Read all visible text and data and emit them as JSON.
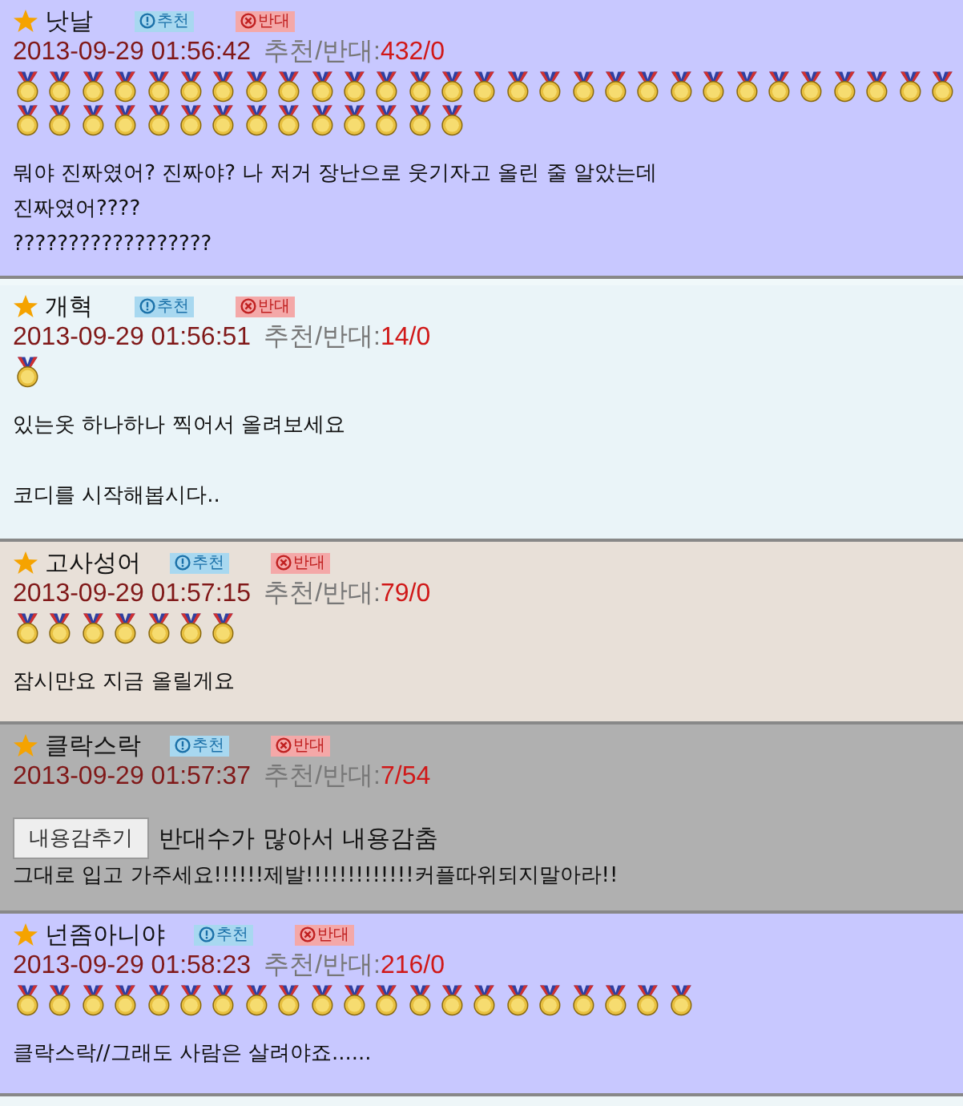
{
  "comments": [
    {
      "kind": "normal",
      "color": "#c8c8ff",
      "author": "낫날",
      "up_label": "추천",
      "down_label": "반대",
      "datetime": "2013-09-29 01:56:42",
      "votes_label": "추천/반대:",
      "votes": "432/0",
      "medals": [
        {
          "kind": "gold"
        },
        {
          "kind": "gold"
        },
        {
          "kind": "gold"
        },
        {
          "kind": "gold"
        },
        {
          "kind": "gold"
        },
        {
          "kind": "gold"
        },
        {
          "kind": "gold"
        },
        {
          "kind": "gold"
        },
        {
          "kind": "gold"
        },
        {
          "kind": "gold"
        },
        {
          "kind": "gold"
        },
        {
          "kind": "gold"
        },
        {
          "kind": "gold"
        },
        {
          "kind": "gold"
        },
        {
          "kind": "gold"
        },
        {
          "kind": "gold"
        },
        {
          "kind": "gold"
        },
        {
          "kind": "gold"
        },
        {
          "kind": "gold"
        },
        {
          "kind": "gold"
        },
        {
          "kind": "gold"
        },
        {
          "kind": "gold"
        },
        {
          "kind": "gold"
        },
        {
          "kind": "gold"
        },
        {
          "kind": "gold"
        },
        {
          "kind": "gold"
        },
        {
          "kind": "gold"
        },
        {
          "kind": "gold"
        },
        {
          "kind": "gold"
        },
        {
          "kind": "gold"
        },
        {
          "kind": "gold"
        },
        {
          "kind": "gold"
        },
        {
          "kind": "gold"
        },
        {
          "kind": "gold"
        },
        {
          "kind": "gold"
        },
        {
          "kind": "gold"
        },
        {
          "kind": "gold"
        },
        {
          "kind": "gold"
        },
        {
          "kind": "gold"
        },
        {
          "kind": "gold"
        },
        {
          "kind": "gold"
        },
        {
          "kind": "gold"
        },
        {
          "kind": "gold"
        }
      ],
      "paragraphs": [
        [
          "뭐야 진짜였어? 진짜야? 나 저거 장난으로 웃기자고 올린 줄 알았는데",
          "진짜였어????",
          "??????????????????"
        ]
      ]
    },
    {
      "kind": "normal",
      "color": "#eaf4f8",
      "author": "개혁",
      "up_label": "추천",
      "down_label": "반대",
      "datetime": "2013-09-29 01:56:51",
      "votes_label": "추천/반대:",
      "votes": "14/0",
      "medals": [
        {
          "kind": "gold"
        }
      ],
      "paragraphs": [
        [
          "있는옷 하나하나 찍어서 올려보세요"
        ],
        [
          "코디를 시작해봅시다.."
        ]
      ]
    },
    {
      "kind": "normal",
      "color": "#e8e0d8",
      "author": "고사성어",
      "up_label": "추천",
      "down_label": "반대",
      "datetime": "2013-09-29 01:57:15",
      "votes_label": "추천/반대:",
      "votes": "79/0",
      "medals": [
        {
          "kind": "gold"
        },
        {
          "kind": "gold"
        },
        {
          "kind": "gold"
        },
        {
          "kind": "gold"
        },
        {
          "kind": "gold"
        },
        {
          "kind": "gold"
        },
        {
          "kind": "gold"
        }
      ],
      "paragraphs": [
        [
          "잠시만요 지금 올릴게요"
        ]
      ]
    },
    {
      "kind": "hidden",
      "color": "#b0b0b0",
      "author": "클락스락",
      "up_label": "추천",
      "down_label": "반대",
      "datetime": "2013-09-29 01:57:37",
      "votes_label": "추천/반대:",
      "votes": "7/54",
      "hide_button": "내용감추기",
      "notice": "반대수가 많아서 내용감춤",
      "paragraphs": [
        [
          "그대로 입고 가주세요!!!!!!제발!!!!!!!!!!!!!커플따위되지말아라!!"
        ]
      ]
    },
    {
      "kind": "normal",
      "color": "#c8c8ff",
      "author": "넌좀아니야",
      "up_label": "추천",
      "down_label": "반대",
      "datetime": "2013-09-29 01:58:23",
      "votes_label": "추천/반대:",
      "votes": "216/0",
      "medals": [
        {
          "kind": "gold"
        },
        {
          "kind": "gold"
        },
        {
          "kind": "gold"
        },
        {
          "kind": "gold"
        },
        {
          "kind": "gold"
        },
        {
          "kind": "gold"
        },
        {
          "kind": "gold"
        },
        {
          "kind": "gold"
        },
        {
          "kind": "gold"
        },
        {
          "kind": "gold"
        },
        {
          "kind": "gold"
        },
        {
          "kind": "gold"
        },
        {
          "kind": "gold"
        },
        {
          "kind": "gold"
        },
        {
          "kind": "gold"
        },
        {
          "kind": "gold"
        },
        {
          "kind": "gold"
        },
        {
          "kind": "gold"
        },
        {
          "kind": "gold"
        },
        {
          "kind": "gold"
        },
        {
          "kind": "gold"
        }
      ],
      "paragraphs": [
        [
          "클락스락//그래도 사람은 살려야죠......"
        ]
      ]
    }
  ]
}
